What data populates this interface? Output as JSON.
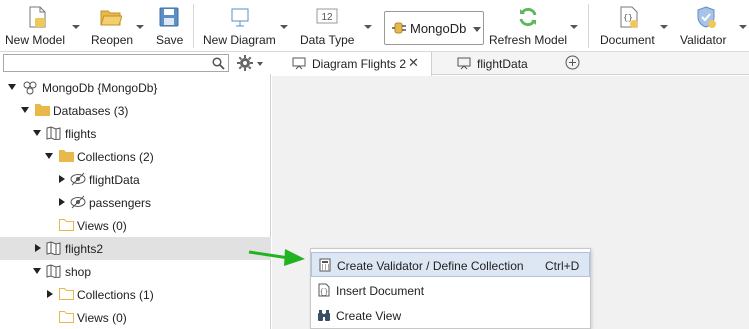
{
  "toolbar": {
    "new_model": "New Model",
    "reopen": "Reopen",
    "save": "Save",
    "new_diagram": "New Diagram",
    "data_type": "Data Type",
    "data_type_badge": "12",
    "db_selector": "MongoDb",
    "refresh_model": "Refresh Model",
    "document": "Document",
    "validator": "Validator"
  },
  "tree": {
    "root": "MongoDb {MongoDb}",
    "databases": "Databases (3)",
    "flights": "flights",
    "collections_flights": "Collections (2)",
    "flightdata": "flightData",
    "passengers": "passengers",
    "views_flights": "Views (0)",
    "flights2": "flights2",
    "shop": "shop",
    "collections_shop": "Collections (1)",
    "views_shop": "Views (0)"
  },
  "tabs": [
    {
      "label": "Diagram Flights 2",
      "close": "✕"
    },
    {
      "label": "flightData"
    }
  ],
  "context_menu": {
    "items": [
      {
        "label": "Create Validator / Define Collection",
        "shortcut": "Ctrl+D"
      },
      {
        "label": "Insert Document"
      },
      {
        "label": "Create View"
      }
    ]
  },
  "colors": {
    "folder": "#e8b84a",
    "accent_green": "#5cb85c",
    "menu_highlight": "#dde7f4",
    "selected_row": "#e1e1e1"
  }
}
